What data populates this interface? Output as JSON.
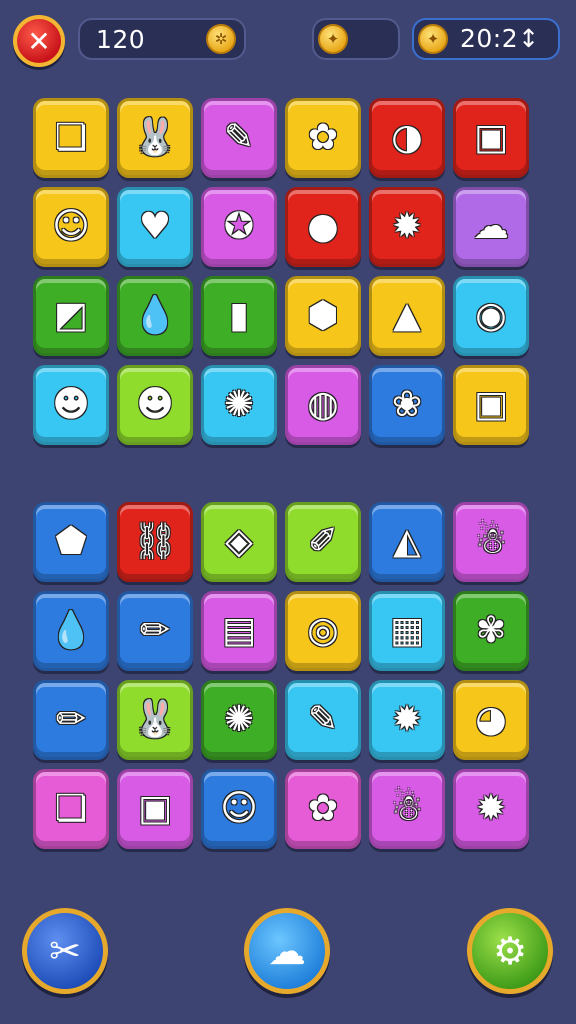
{
  "hud": {
    "close_icon": "✕",
    "score": "120",
    "score_coin_icon": "✲",
    "mid_coin_icon": "✦",
    "timer_coin_icon": "✦",
    "timer": "20:2↕"
  },
  "colors": {
    "yellow": "#f7c61a",
    "red": "#e0241c",
    "magenta": "#d85be6",
    "blue": "#2e7be0",
    "cyan": "#38c6f2",
    "green": "#3fae27",
    "lime": "#8fdc2c",
    "purple": "#b06ae8",
    "pink": "#e65bd6"
  },
  "board_top": [
    {
      "color": "#f7c61a",
      "icon": "❏",
      "name": "gift-box"
    },
    {
      "color": "#f7c61a",
      "icon": "🐰",
      "name": "bunny"
    },
    {
      "color": "#d85be6",
      "icon": "✎",
      "name": "pin"
    },
    {
      "color": "#f7c61a",
      "icon": "✿",
      "name": "green-blob"
    },
    {
      "color": "#e0241c",
      "icon": "◑",
      "name": "face-circle"
    },
    {
      "color": "#e0241c",
      "icon": "▣",
      "name": "bag"
    },
    {
      "color": "#f7c61a",
      "icon": "☺",
      "name": "kid-face"
    },
    {
      "color": "#38c6f2",
      "icon": "♥",
      "name": "heart"
    },
    {
      "color": "#d85be6",
      "icon": "✪",
      "name": "orange-bird"
    },
    {
      "color": "#e0241c",
      "icon": "●",
      "name": "blue-orb"
    },
    {
      "color": "#e0241c",
      "icon": "✹",
      "name": "sun-face"
    },
    {
      "color": "#b06ae8",
      "icon": "☁",
      "name": "blue-cloud"
    },
    {
      "color": "#3fae27",
      "icon": "◩",
      "name": "blue-block"
    },
    {
      "color": "#3fae27",
      "icon": "💧",
      "name": "red-drop"
    },
    {
      "color": "#3fae27",
      "icon": "▮",
      "name": "red-cup"
    },
    {
      "color": "#f7c61a",
      "icon": "⬢",
      "name": "green-hex"
    },
    {
      "color": "#f7c61a",
      "icon": "▲",
      "name": "purple-drop"
    },
    {
      "color": "#38c6f2",
      "icon": "◉",
      "name": "yellow-bird"
    },
    {
      "color": "#38c6f2",
      "icon": "☻",
      "name": "red-hair-face"
    },
    {
      "color": "#8fdc2c",
      "icon": "☻",
      "name": "pink-face"
    },
    {
      "color": "#38c6f2",
      "icon": "✺",
      "name": "orange-monster"
    },
    {
      "color": "#d85be6",
      "icon": "◍",
      "name": "orange-shell"
    },
    {
      "color": "#2e7be0",
      "icon": "❀",
      "name": "flower-face"
    },
    {
      "color": "#f7c61a",
      "icon": "▣",
      "name": "red-case"
    }
  ],
  "board_bottom": [
    {
      "color": "#2e7be0",
      "icon": "⬟",
      "name": "blue-gem"
    },
    {
      "color": "#e0241c",
      "icon": "⛓",
      "name": "chain"
    },
    {
      "color": "#8fdc2c",
      "icon": "◈",
      "name": "red-heart"
    },
    {
      "color": "#8fdc2c",
      "icon": "✐",
      "name": "carrot"
    },
    {
      "color": "#2e7be0",
      "icon": "◭",
      "name": "green-map"
    },
    {
      "color": "#d85be6",
      "icon": "☃",
      "name": "white-ghost"
    },
    {
      "color": "#2e7be0",
      "icon": "💧",
      "name": "red-drop"
    },
    {
      "color": "#2e7be0",
      "icon": "✏",
      "name": "pink-crayon"
    },
    {
      "color": "#d85be6",
      "icon": "▤",
      "name": "photo-frame"
    },
    {
      "color": "#f7c61a",
      "icon": "◎",
      "name": "blue-bubble"
    },
    {
      "color": "#38c6f2",
      "icon": "▦",
      "name": "green-bag"
    },
    {
      "color": "#3fae27",
      "icon": "✾",
      "name": "orange-splat"
    },
    {
      "color": "#2e7be0",
      "icon": "✏",
      "name": "yellow-pencil"
    },
    {
      "color": "#8fdc2c",
      "icon": "🐰",
      "name": "bunny"
    },
    {
      "color": "#3fae27",
      "icon": "✺",
      "name": "orange-gear"
    },
    {
      "color": "#38c6f2",
      "icon": "✎",
      "name": "green-brush"
    },
    {
      "color": "#38c6f2",
      "icon": "✹",
      "name": "orange-sun"
    },
    {
      "color": "#f7c61a",
      "icon": "◕",
      "name": "red-bomb"
    },
    {
      "color": "#e65bd6",
      "icon": "❏",
      "name": "gift-box"
    },
    {
      "color": "#d85be6",
      "icon": "▣",
      "name": "blue-case"
    },
    {
      "color": "#2e7be0",
      "icon": "☺",
      "name": "orange-smiley"
    },
    {
      "color": "#e65bd6",
      "icon": "✿",
      "name": "green-blob"
    },
    {
      "color": "#d85be6",
      "icon": "☃",
      "name": "pink-ghost"
    },
    {
      "color": "#d85be6",
      "icon": "✹",
      "name": "yellow-sun"
    }
  ],
  "bottom_bar": {
    "left_icon": "✂",
    "mid_icon": "☁",
    "right_icon": "⚙"
  }
}
